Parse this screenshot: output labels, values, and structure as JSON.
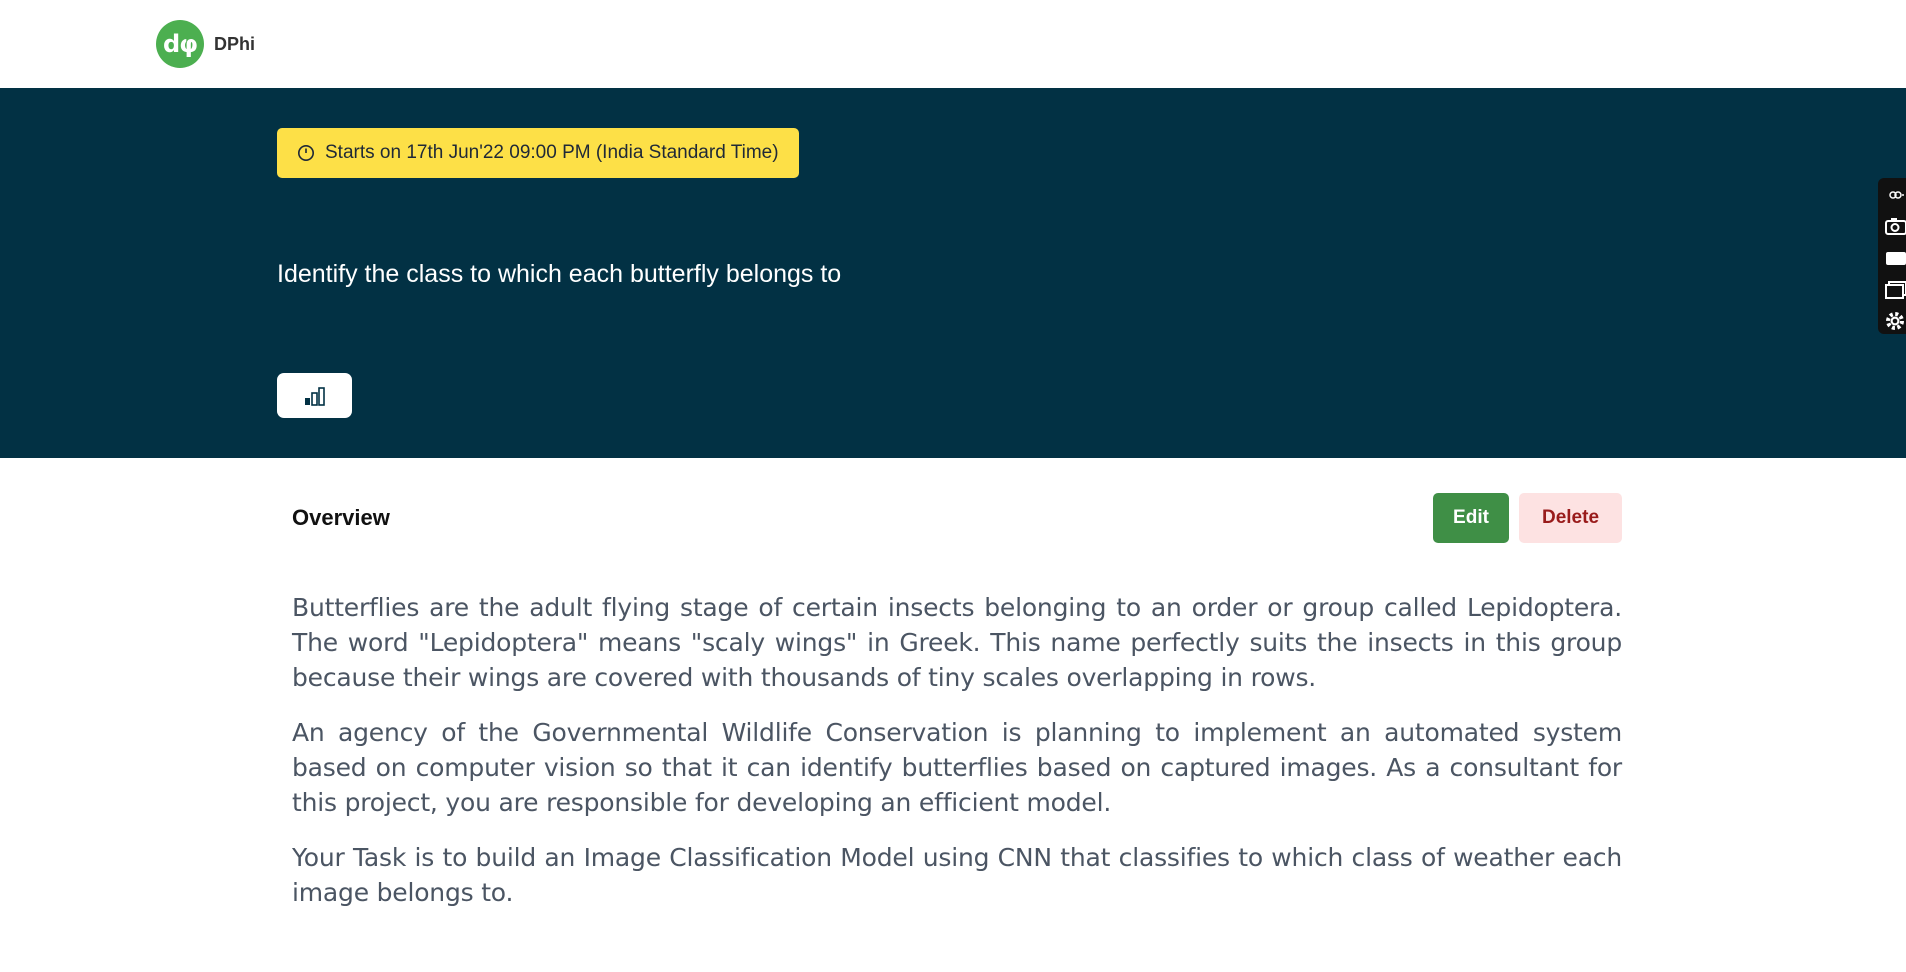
{
  "brand": {
    "logo_mark": "dφ",
    "name": "DPhi"
  },
  "hero": {
    "start_badge": "Starts on 17th Jun'22 09:00 PM (India Standard Time)",
    "title": "Identify the class to which each butterfly belongs to",
    "stats_icon": "bar-chart-icon"
  },
  "side_tools": [
    "link-icon",
    "camera-icon",
    "video-icon",
    "window-icon",
    "gear-icon"
  ],
  "overview": {
    "title": "Overview",
    "edit_label": "Edit",
    "delete_label": "Delete",
    "paragraphs": [
      "Butterflies are the adult flying stage of certain insects belonging to an order or group called Lepidoptera. The word \"Lepidoptera\" means \"scaly wings\" in Greek. This name perfectly suits the insects in this group because their wings are covered with thousands of tiny scales overlapping in rows.",
      "An agency of the Governmental Wildlife Conservation is planning to implement an automated system based on computer vision so that it can identify butterflies based on captured images. As a consultant for this project, you are responsible for developing an efficient model.",
      "Your Task is to build an Image Classification Model using CNN that classifies to which class of weather each image belongs to."
    ]
  },
  "colors": {
    "hero_bg": "#023144",
    "badge_bg": "#fde047",
    "edit_bg": "#3f8f46",
    "delete_bg": "#fde2e2",
    "brand_green": "#4caf50"
  }
}
